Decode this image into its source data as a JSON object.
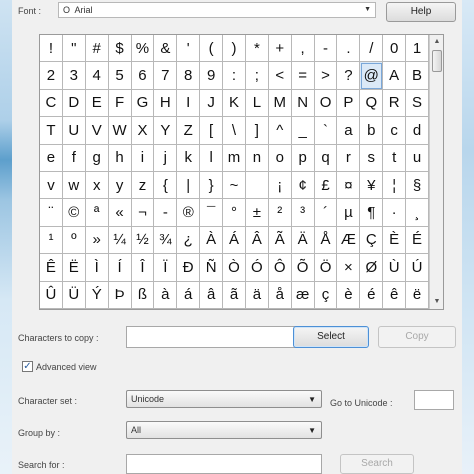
{
  "top": {
    "font_label": "Font :",
    "font_icon": "O",
    "font_value": "Arial",
    "help_label": "Help"
  },
  "grid": {
    "rows": [
      [
        "!",
        "\"",
        "#",
        "$",
        "%",
        "&",
        "'",
        "(",
        ")",
        "*",
        "+",
        ",",
        "-",
        ".",
        "/",
        "0",
        "1"
      ],
      [
        "2",
        "3",
        "4",
        "5",
        "6",
        "7",
        "8",
        "9",
        ":",
        ";",
        "<",
        "=",
        ">",
        "?",
        "@",
        "A",
        "B"
      ],
      [
        "C",
        "D",
        "E",
        "F",
        "G",
        "H",
        "I",
        "J",
        "K",
        "L",
        "M",
        "N",
        "O",
        "P",
        "Q",
        "R",
        "S"
      ],
      [
        "T",
        "U",
        "V",
        "W",
        "X",
        "Y",
        "Z",
        "[",
        "\\",
        "]",
        "^",
        "_",
        "`",
        "a",
        "b",
        "c",
        "d"
      ],
      [
        "e",
        "f",
        "g",
        "h",
        "i",
        "j",
        "k",
        "l",
        "m",
        "n",
        "o",
        "p",
        "q",
        "r",
        "s",
        "t",
        "u"
      ],
      [
        "v",
        "w",
        "x",
        "y",
        "z",
        "{",
        "|",
        "}",
        "~",
        " ",
        "¡",
        "¢",
        "£",
        "¤",
        "¥",
        "¦",
        "§"
      ],
      [
        "¨",
        "©",
        "ª",
        "«",
        "¬",
        "-",
        "®",
        "¯",
        "°",
        "±",
        "²",
        "³",
        "´",
        "µ",
        "¶",
        "·",
        "¸"
      ],
      [
        "¹",
        "º",
        "»",
        "¼",
        "½",
        "¾",
        "¿",
        "À",
        "Á",
        "Â",
        "Ã",
        "Ä",
        "Å",
        "Æ",
        "Ç",
        "È",
        "É"
      ],
      [
        "Ê",
        "Ë",
        "Ì",
        "Í",
        "Î",
        "Ï",
        "Ð",
        "Ñ",
        "Ò",
        "Ó",
        "Ô",
        "Õ",
        "Ö",
        "×",
        "Ø",
        "Ù",
        "Ú"
      ],
      [
        "Û",
        "Ü",
        "Ý",
        "Þ",
        "ß",
        "à",
        "á",
        "â",
        "ã",
        "ä",
        "å",
        "æ",
        "ç",
        "è",
        "é",
        "ê",
        "ë"
      ]
    ],
    "selected": "@"
  },
  "copy": {
    "label": "Characters to copy :",
    "value": "",
    "select_label": "Select",
    "copy_label": "Copy"
  },
  "advanced": {
    "checked_mark": "✓",
    "label": "Advanced view"
  },
  "charset": {
    "label": "Character set :",
    "value": "Unicode",
    "goto_label": "Go to Unicode :",
    "goto_value": ""
  },
  "groupby": {
    "label": "Group by :",
    "value": "All"
  },
  "search": {
    "label": "Search for :",
    "value": "",
    "button_label": "Search"
  },
  "icons": {
    "dropdown": "chevron-down-icon",
    "scroll_up": "chevron-up-icon",
    "scroll_down": "chevron-down-icon"
  }
}
